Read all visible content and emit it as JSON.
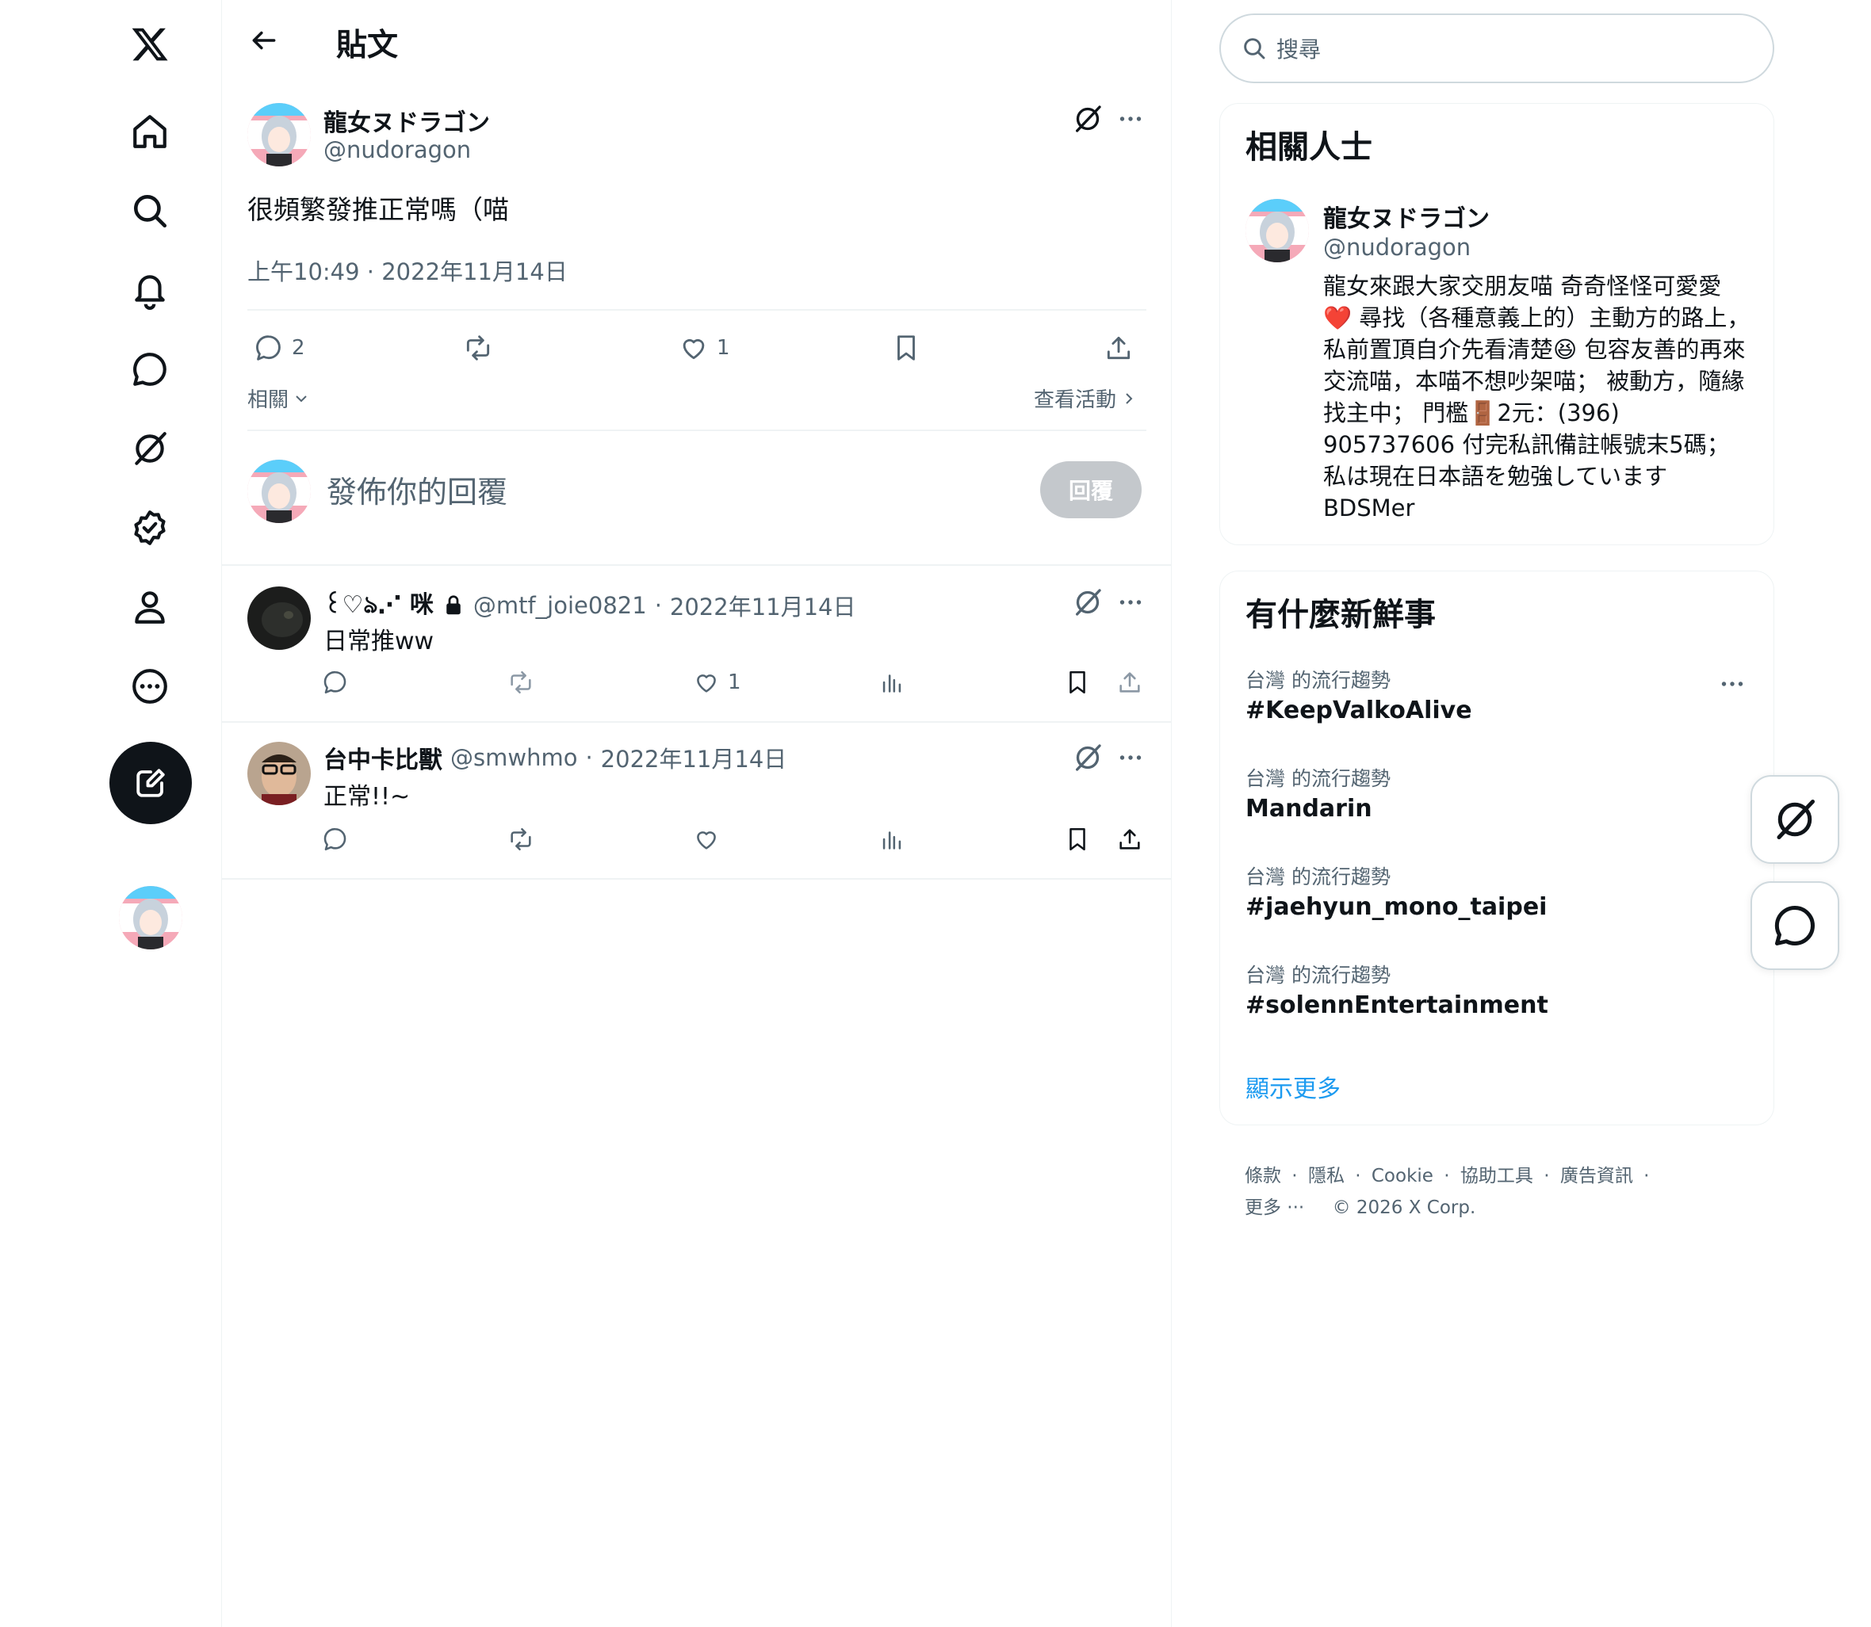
{
  "nav": {
    "icons": [
      "x-logo-icon",
      "home-icon",
      "search-icon",
      "notifications-icon",
      "messages-icon",
      "grok-icon",
      "verified-icon",
      "profile-icon",
      "more-icon"
    ],
    "compose_icon": "compose-icon"
  },
  "header": {
    "back_icon": "back-arrow-icon",
    "title": "貼文"
  },
  "post": {
    "name": "龍女ヌドラゴン",
    "handle": "@nudoragon",
    "text": "很頻繁發推正常嗎（喵",
    "timestamp": "上午10:49 · 2022年11月14日",
    "replies": "2",
    "likes": "1",
    "related_label": "相關",
    "activity_label": "查看活動"
  },
  "composer": {
    "placeholder": "發佈你的回覆",
    "button": "回覆"
  },
  "replies": [
    {
      "name": "꒰♡ঌ⋰ 咪",
      "handle": "@mtf_joie0821",
      "date": "2022年11月14日",
      "text": "日常推ww",
      "likes": "1",
      "locked": true
    },
    {
      "name": "台中卡比獸",
      "handle": "@smwhmo",
      "date": "2022年11月14日",
      "text": "正常!!~",
      "likes": ""
    }
  ],
  "search": {
    "placeholder": "搜尋"
  },
  "related": {
    "title": "相關人士",
    "name": "龍女ヌドラゴン",
    "handle": "@nudoragon",
    "bio": "龍女來跟大家交朋友喵 奇奇怪怪可愛愛 ❤️ 尋找（各種意義上的）主動方的路上， 私前置頂自介先看清楚😆 包容友善的再來交流喵，本喵不想吵架喵； 被動方，隨緣找主中； 門檻🚪2元：(396) 905737606 付完私訊備註帳號末5碼； 私は現在日本語を勉強しています BDSMer"
  },
  "trends": {
    "title": "有什麼新鮮事",
    "items": [
      {
        "label": "台灣 的流行趨勢",
        "name": "#KeepValkoAlive"
      },
      {
        "label": "台灣 的流行趨勢",
        "name": "Mandarin"
      },
      {
        "label": "台灣 的流行趨勢",
        "name": "#jaehyun_mono_taipei"
      },
      {
        "label": "台灣 的流行趨勢",
        "name": "#solennEntertainment"
      }
    ],
    "show_more": "顯示更多"
  },
  "footer": {
    "links": [
      "條款",
      "隱私",
      "Cookie",
      "協助工具",
      "廣告資訊"
    ],
    "more": "更多 ···",
    "copyright": "© 2026 X Corp."
  },
  "colors": {
    "text": "#0f1419",
    "muted": "#536471",
    "accent": "#1d9bf0",
    "border": "#eff3f4",
    "like_red": "#f91880"
  }
}
